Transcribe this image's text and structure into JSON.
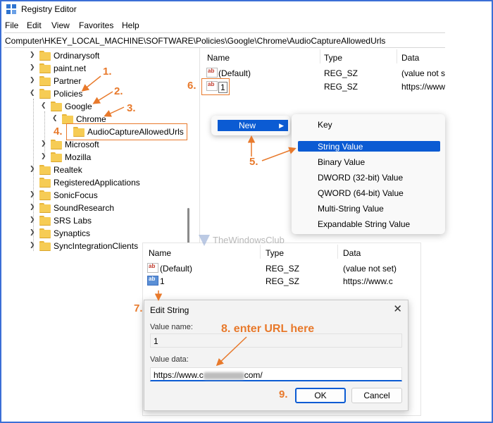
{
  "window": {
    "title": "Registry Editor"
  },
  "menu": [
    "File",
    "Edit",
    "View",
    "Favorites",
    "Help"
  ],
  "address": "Computer\\HKEY_LOCAL_MACHINE\\SOFTWARE\\Policies\\Google\\Chrome\\AudioCaptureAllowedUrls",
  "tree": [
    {
      "label": "Ordinarysoft"
    },
    {
      "label": "paint.net"
    },
    {
      "label": "Partner"
    },
    {
      "label": "Policies"
    },
    {
      "label": "Google"
    },
    {
      "label": "Chrome"
    },
    {
      "label": "AudioCaptureAllowedUrls"
    },
    {
      "label": "Microsoft"
    },
    {
      "label": "Mozilla"
    },
    {
      "label": "Realtek"
    },
    {
      "label": "RegisteredApplications"
    },
    {
      "label": "SonicFocus"
    },
    {
      "label": "SoundResearch"
    },
    {
      "label": "SRS Labs"
    },
    {
      "label": "Synaptics"
    },
    {
      "label": "SyncIntegrationClients"
    }
  ],
  "columns": {
    "name": "Name",
    "type": "Type",
    "data": "Data"
  },
  "values_top": [
    {
      "name": "(Default)",
      "type": "REG_SZ",
      "data": "(value not se"
    },
    {
      "name": "1",
      "type": "REG_SZ",
      "data": "https://www"
    }
  ],
  "context_menu_1": {
    "new_label": "New"
  },
  "context_menu_2": [
    "Key",
    "String Value",
    "Binary Value",
    "DWORD (32-bit) Value",
    "QWORD (64-bit) Value",
    "Multi-String Value",
    "Expandable String Value"
  ],
  "values_bottom": [
    {
      "name": "(Default)",
      "type": "REG_SZ",
      "data": "(value not set)"
    },
    {
      "name": "1",
      "type": "REG_SZ",
      "data": "https://www.c"
    }
  ],
  "watermark": "TheWindowsClub",
  "dialog": {
    "title": "Edit String",
    "close": "✕",
    "value_name_label": "Value name:",
    "value_name": "1",
    "value_data_label": "Value data:",
    "value_data_prefix": "https://www.c",
    "value_data_suffix": "com/",
    "ok": "OK",
    "cancel": "Cancel"
  },
  "callouts": {
    "c1": "1.",
    "c2": "2.",
    "c3": "3.",
    "c4": "4.",
    "c5": "5.",
    "c6": "6.",
    "c7": "7.",
    "c8": "8. enter URL here",
    "c9": "9."
  },
  "colors": {
    "accent": "#0b5bd3",
    "callout": "#e8792b",
    "frame": "#3b6fd6",
    "folder": "#f6cc55"
  }
}
